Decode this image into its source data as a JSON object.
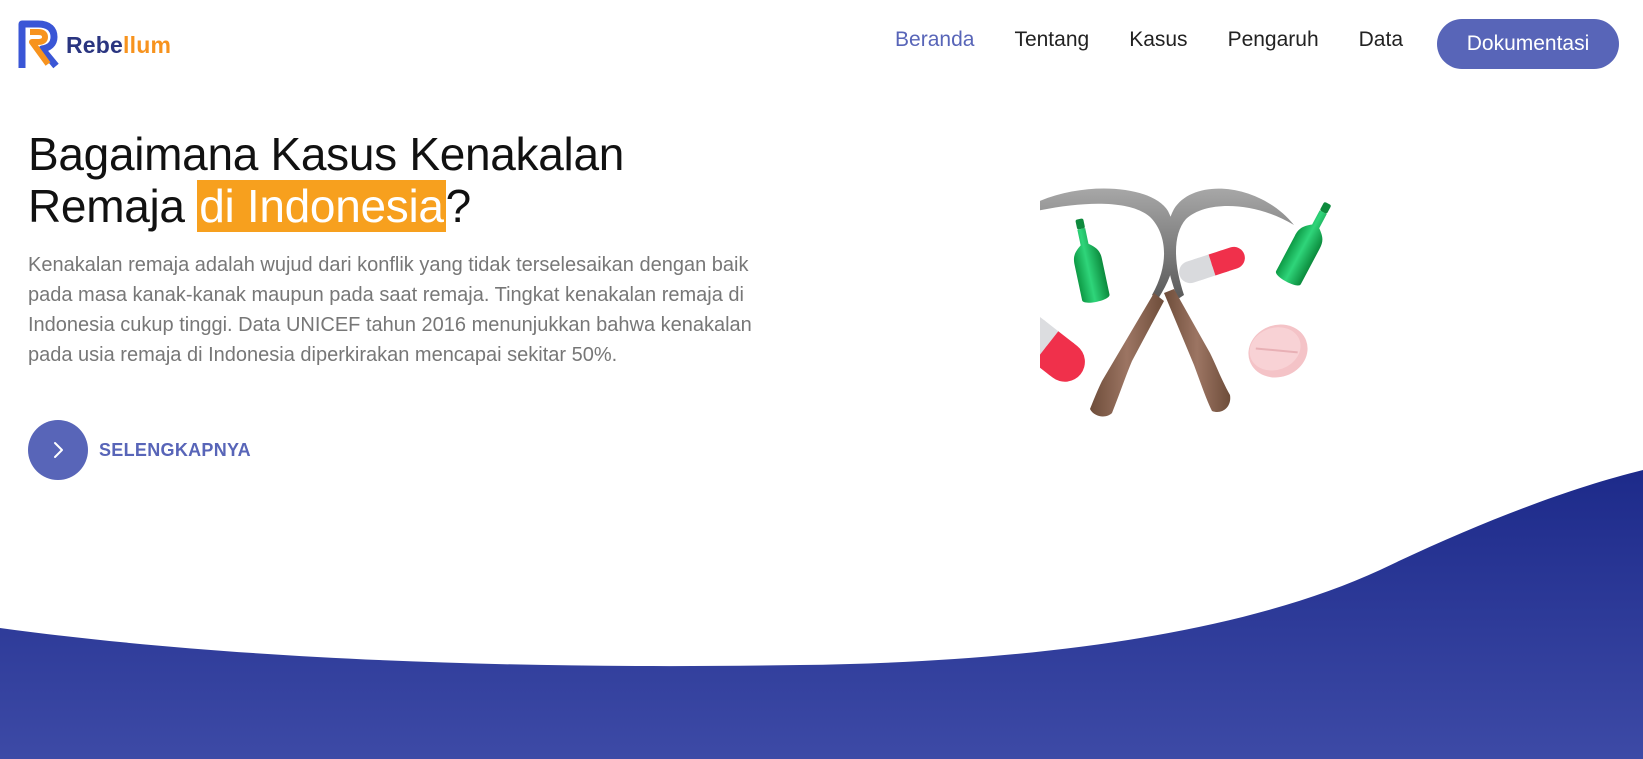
{
  "brand": {
    "name_part1": "Rebe",
    "name_part2": "llum",
    "colors": {
      "primary": "#5865b8",
      "orange": "#f7931e",
      "navy": "#2a3580"
    }
  },
  "nav": {
    "links": [
      {
        "label": "Beranda",
        "active": true
      },
      {
        "label": "Tentang",
        "active": false
      },
      {
        "label": "Kasus",
        "active": false
      },
      {
        "label": "Pengaruh",
        "active": false
      },
      {
        "label": "Data",
        "active": false
      }
    ],
    "cta_label": "Dokumentasi"
  },
  "hero": {
    "title_line1": "Bagaimana Kasus Kenakalan",
    "title_line2_prefix": "Remaja ",
    "title_highlight": "di Indonesia",
    "title_suffix": "?",
    "description": "Kenakalan remaja adalah wujud dari konflik yang tidak terselesaikan dengan baik pada masa kanak-kanak maupun pada saat remaja. Tingkat kenakalan remaja di Indonesia cukup tinggi. Data UNICEF tahun 2016 menunjukkan bahwa kenakalan pada usia remaja di Indonesia diperkirakan mencapai sekitar 50%.",
    "more_label": "SELENGKAPNYA",
    "more_icon": "chevron-right-icon",
    "illustration": "sickles-bottles-pills-illustration"
  },
  "wave_colors": {
    "top": "#1d2a8a",
    "bottom": "#3d4aa6"
  }
}
